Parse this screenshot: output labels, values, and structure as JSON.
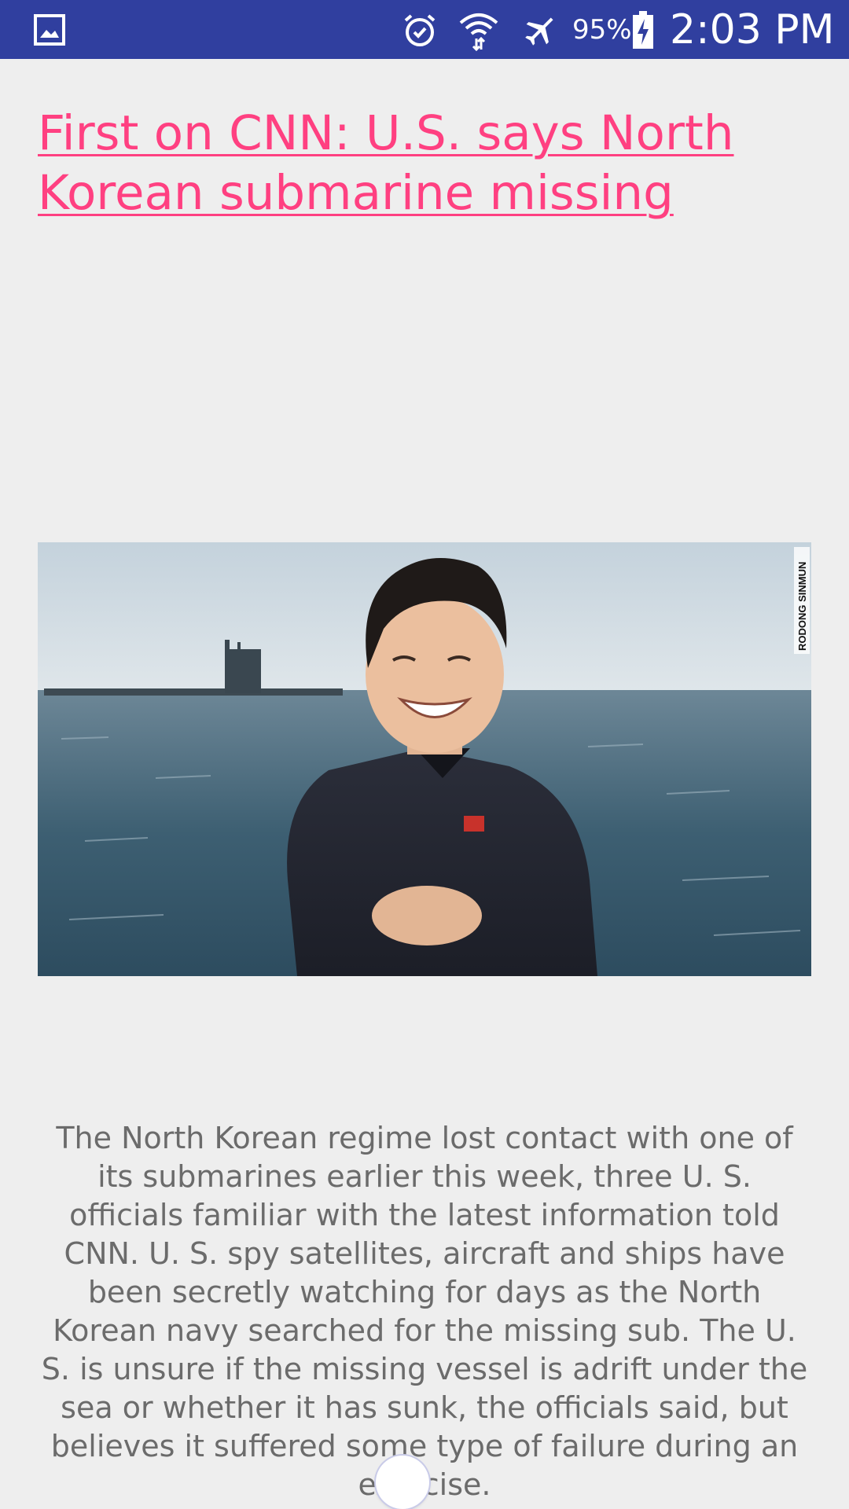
{
  "status_bar": {
    "battery_percent": "95%",
    "time": "2:03 PM",
    "icons": [
      "gallery-notification-icon",
      "alarm-icon",
      "wifi-icon",
      "airplane-mode-icon",
      "battery-charging-icon"
    ],
    "background_color": "#303f9f"
  },
  "article": {
    "headline": "First on CNN: U.S. says North Korean submarine missing",
    "image": {
      "credit": "RODONG SINMUN"
    },
    "body": "The North Korean regime lost contact with one of its submarines earlier this week, three U. S. officials familiar with the latest information told CNN. U. S. spy satellites, aircraft and ships have been secretly watching for days as the North Korean navy searched for the missing sub. The U. S. is unsure if the missing vessel is adrift under the sea or whether it has sunk, the officials said, but believes it suffered some type of failure during an exercise."
  },
  "colors": {
    "headline": "#ff4081",
    "body_text": "#6b6b6b",
    "background": "#eeeeee"
  }
}
